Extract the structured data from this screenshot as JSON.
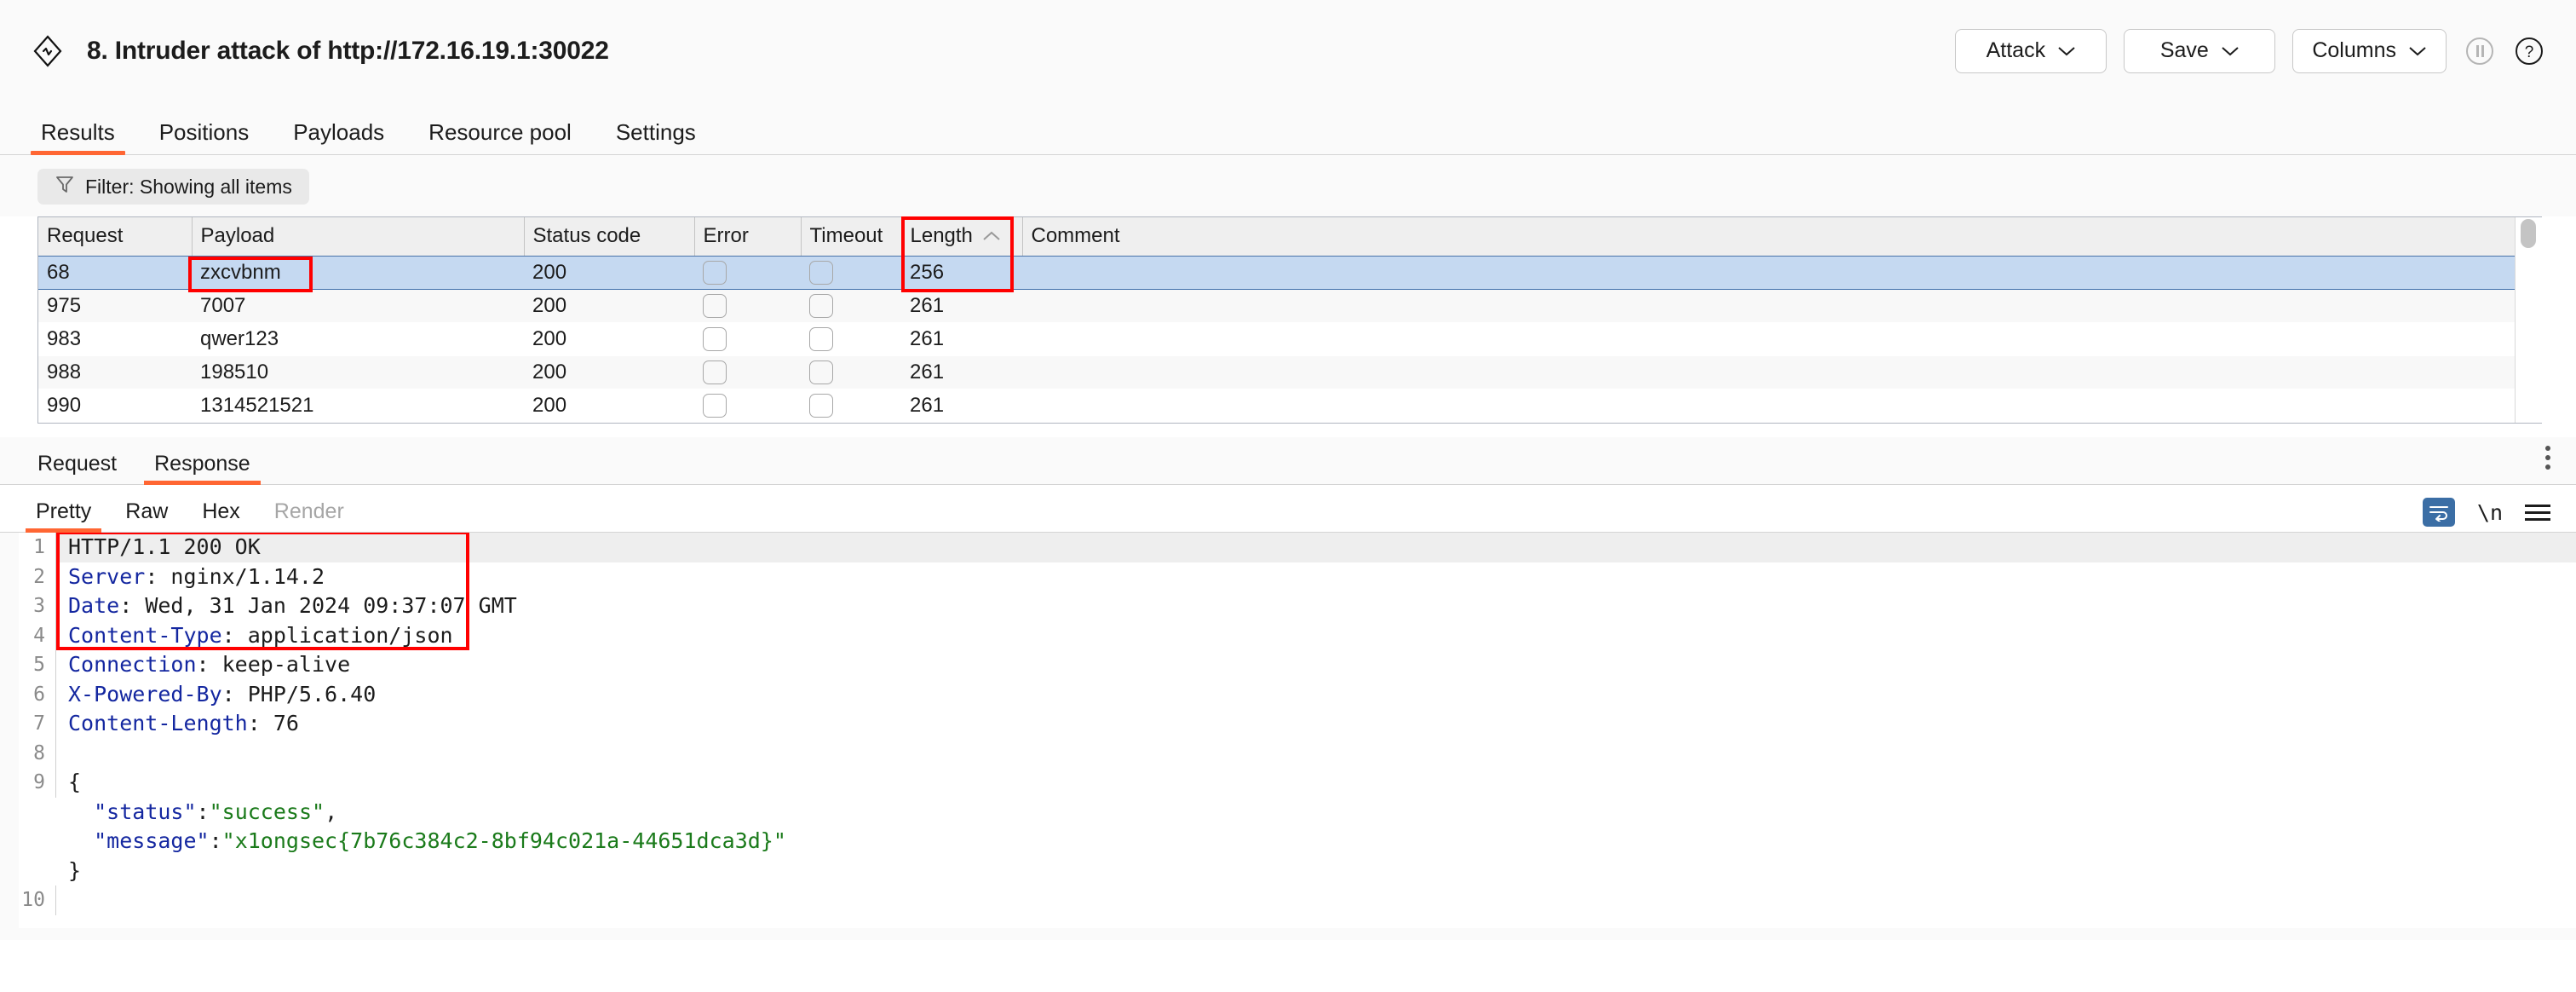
{
  "header": {
    "logo_icon": "burp-suite-logo-icon",
    "title": "8. Intruder attack of http://172.16.19.1:30022",
    "actions": [
      {
        "label": "Attack",
        "icon": "chevron-down-icon"
      },
      {
        "label": "Save",
        "icon": "chevron-down-icon"
      },
      {
        "label": "Columns",
        "icon": "chevron-down-icon"
      }
    ],
    "pause_icon": "pause-icon",
    "help_icon": "help-circle-icon"
  },
  "main_tabs": [
    {
      "label": "Results",
      "active": true
    },
    {
      "label": "Positions",
      "active": false
    },
    {
      "label": "Payloads",
      "active": false
    },
    {
      "label": "Resource pool",
      "active": false
    },
    {
      "label": "Settings",
      "active": false
    }
  ],
  "filter": {
    "icon": "funnel-icon",
    "label": "Filter: Showing all items"
  },
  "results_table": {
    "columns": [
      "Request",
      "Payload",
      "Status code",
      "Error",
      "Timeout",
      "Length",
      "Comment"
    ],
    "sorted_column": "Length",
    "sort_direction": "ascending",
    "sort_icon": "chevron-up-icon",
    "rows": [
      {
        "request": "68",
        "payload": "zxcvbnm",
        "status": "200",
        "error": false,
        "timeout": false,
        "length": "256",
        "comment": "",
        "selected": true
      },
      {
        "request": "975",
        "payload": "7007",
        "status": "200",
        "error": false,
        "timeout": false,
        "length": "261",
        "comment": "",
        "selected": false
      },
      {
        "request": "983",
        "payload": "qwer123",
        "status": "200",
        "error": false,
        "timeout": false,
        "length": "261",
        "comment": "",
        "selected": false
      },
      {
        "request": "988",
        "payload": "198510",
        "status": "200",
        "error": false,
        "timeout": false,
        "length": "261",
        "comment": "",
        "selected": false
      },
      {
        "request": "990",
        "payload": "1314521521",
        "status": "200",
        "error": false,
        "timeout": false,
        "length": "261",
        "comment": "",
        "selected": false
      }
    ]
  },
  "message_tabs": [
    {
      "label": "Request",
      "active": false
    },
    {
      "label": "Response",
      "active": true
    }
  ],
  "message_menu_icon": "kebab-menu-icon",
  "view_tabs": [
    {
      "label": "Pretty",
      "active": true,
      "disabled": false
    },
    {
      "label": "Raw",
      "active": false,
      "disabled": false
    },
    {
      "label": "Hex",
      "active": false,
      "disabled": false
    },
    {
      "label": "Render",
      "active": false,
      "disabled": true
    }
  ],
  "view_actions": {
    "wrap_icon": "word-wrap-icon",
    "newline_label": "\\n",
    "menu_icon": "hamburger-menu-icon"
  },
  "response": {
    "lines": [
      {
        "n": "1",
        "highlight": true,
        "parts": [
          {
            "t": "HTTP/1.1 200 OK",
            "c": "hdr-val"
          }
        ]
      },
      {
        "n": "2",
        "highlight": false,
        "parts": [
          {
            "t": "Server",
            "c": "hdr-name"
          },
          {
            "t": ": nginx/1.14.2",
            "c": "hdr-val"
          }
        ]
      },
      {
        "n": "3",
        "highlight": false,
        "parts": [
          {
            "t": "Date",
            "c": "hdr-name"
          },
          {
            "t": ": Wed, 31 Jan 2024 09:37:07 GMT",
            "c": "hdr-val"
          }
        ]
      },
      {
        "n": "4",
        "highlight": false,
        "parts": [
          {
            "t": "Content-Type",
            "c": "hdr-name"
          },
          {
            "t": ": application/json",
            "c": "hdr-val"
          }
        ]
      },
      {
        "n": "5",
        "highlight": false,
        "parts": [
          {
            "t": "Connection",
            "c": "hdr-name"
          },
          {
            "t": ": keep-alive",
            "c": "hdr-val"
          }
        ]
      },
      {
        "n": "6",
        "highlight": false,
        "parts": [
          {
            "t": "X-Powered-By",
            "c": "hdr-name"
          },
          {
            "t": ": PHP/5.6.40",
            "c": "hdr-val"
          }
        ]
      },
      {
        "n": "7",
        "highlight": false,
        "parts": [
          {
            "t": "Content-Length",
            "c": "hdr-name"
          },
          {
            "t": ": 76",
            "c": "hdr-val"
          }
        ]
      },
      {
        "n": "8",
        "highlight": false,
        "parts": []
      },
      {
        "n": "9",
        "highlight": false,
        "parts": [
          {
            "t": "{",
            "c": "j-punct"
          }
        ]
      },
      {
        "n": "",
        "highlight": false,
        "parts": [
          {
            "t": "  ",
            "c": "j-punct"
          },
          {
            "t": "\"status\"",
            "c": "j-key"
          },
          {
            "t": ":",
            "c": "j-punct"
          },
          {
            "t": "\"success\"",
            "c": "j-str"
          },
          {
            "t": ",",
            "c": "j-punct"
          }
        ]
      },
      {
        "n": "",
        "highlight": false,
        "parts": [
          {
            "t": "  ",
            "c": "j-punct"
          },
          {
            "t": "\"message\"",
            "c": "j-key"
          },
          {
            "t": ":",
            "c": "j-punct"
          },
          {
            "t": "\"x1ongsec{7b76c384c2-8bf94c021a-44651dca3d}\"",
            "c": "j-str"
          }
        ]
      },
      {
        "n": "",
        "highlight": false,
        "parts": [
          {
            "t": "}",
            "c": "j-punct"
          }
        ]
      },
      {
        "n": "10",
        "highlight": false,
        "parts": []
      }
    ],
    "flag_value": "x1ongsec{7b76c384c2-8bf94c021a-44651dca3d}"
  },
  "colors": {
    "accent": "#ff6633",
    "selected_row": "#c5d9f1",
    "annotation": "#ff0000",
    "header_name": "#1427a0",
    "json_string": "#1a7a1a"
  }
}
